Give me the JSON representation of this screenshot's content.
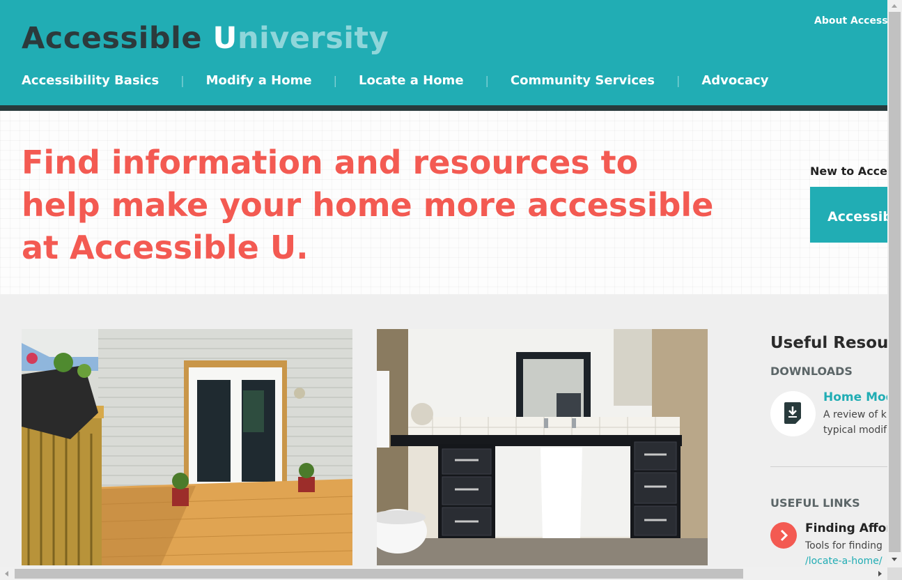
{
  "header": {
    "about_link": "About Accessib",
    "logo": {
      "part1": "Accessible ",
      "part2": "U",
      "part3": "niversity"
    },
    "nav": [
      {
        "label": "Accessibility Basics"
      },
      {
        "label": "Modify a Home"
      },
      {
        "label": "Locate a Home"
      },
      {
        "label": "Community Services"
      },
      {
        "label": "Advocacy"
      }
    ],
    "separator": "|"
  },
  "hero": {
    "heading": "Find information and resources to help make your home more accessible at Accessible U.",
    "new_to_label": "New to Access",
    "cta_button": "Accessib"
  },
  "sidebar": {
    "title": "Useful Resourc",
    "downloads_heading": "DOWNLOADS",
    "download": {
      "title": "Home Mod",
      "desc_line1": "A review of k",
      "desc_line2": "typical modif"
    },
    "links_heading": "USEFUL LINKS",
    "link": {
      "title": "Finding Afford",
      "desc": "Tools for finding",
      "url": "/locate-a-home/"
    }
  },
  "colors": {
    "teal": "#21adb4",
    "dark_bar": "#283a3c",
    "coral": "#f35a52",
    "logo_dark": "#2c3a3c",
    "logo_light": "#8fd6da"
  },
  "images": [
    {
      "name": "deck-french-doors-photo"
    },
    {
      "name": "accessible-bathroom-vanity-photo"
    }
  ]
}
